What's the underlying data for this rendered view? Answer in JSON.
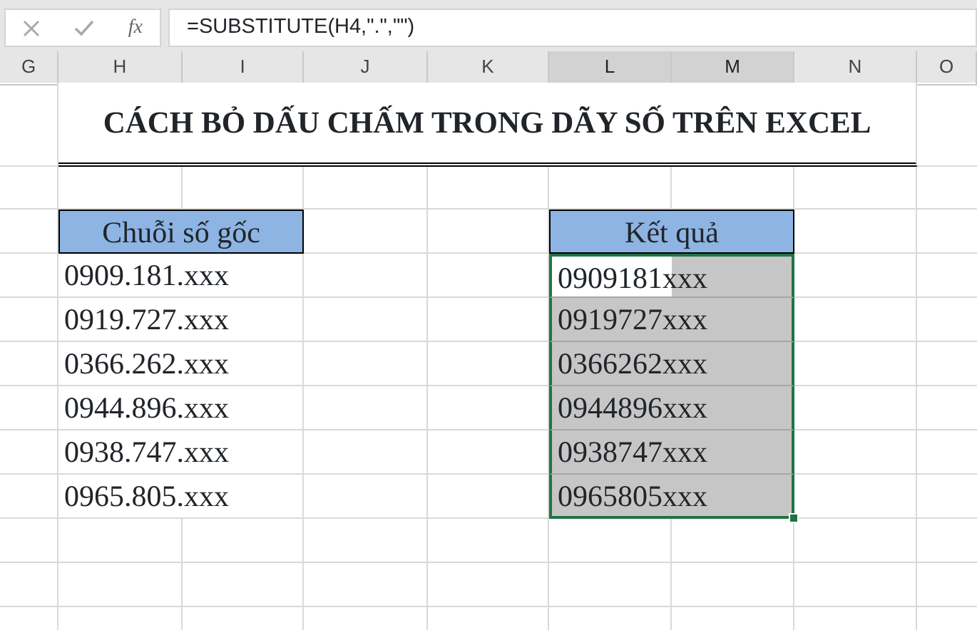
{
  "formula_bar": {
    "function_label": "fx",
    "formula": "=SUBSTITUTE(H4,\".\",\"\")"
  },
  "column_headers": [
    {
      "label": "G",
      "selected": false
    },
    {
      "label": "H",
      "selected": false
    },
    {
      "label": "I",
      "selected": false
    },
    {
      "label": "J",
      "selected": false
    },
    {
      "label": "K",
      "selected": false
    },
    {
      "label": "L",
      "selected": true
    },
    {
      "label": "M",
      "selected": true
    },
    {
      "label": "N",
      "selected": false
    },
    {
      "label": "O",
      "selected": false
    }
  ],
  "title": "CÁCH BỎ DẤU CHẤM TRONG DÃY SỐ TRÊN EXCEL",
  "source": {
    "header": "Chuỗi số gốc",
    "cells": [
      "0909.181.xxx",
      "0919.727.xxx",
      "0366.262.xxx",
      "0944.896.xxx",
      "0938.747.xxx",
      "0965.805.xxx"
    ]
  },
  "result": {
    "header": "Kết quả",
    "cells": [
      {
        "value": "0909181xxx",
        "selected": true,
        "active": true
      },
      {
        "value": "0919727xxx",
        "selected": true,
        "active": false
      },
      {
        "value": "0366262xxx",
        "selected": true,
        "active": false
      },
      {
        "value": "0944896xxx",
        "selected": true,
        "active": false
      },
      {
        "value": "0938747xxx",
        "selected": true,
        "active": false
      },
      {
        "value": "0965805xxx",
        "selected": true,
        "active": false
      }
    ]
  }
}
